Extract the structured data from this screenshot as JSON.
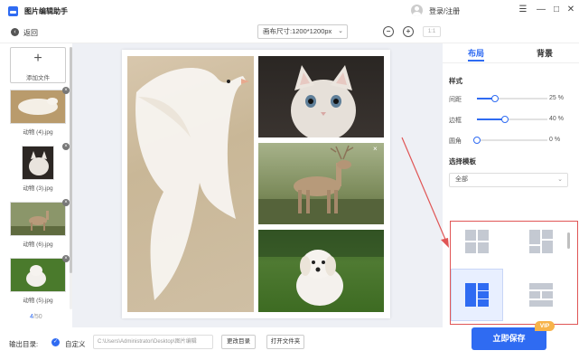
{
  "app": {
    "title": "图片编辑助手",
    "login_label": "登录/注册",
    "window_controls": [
      "menu-icon",
      "minimize-icon",
      "maximize-icon",
      "close-icon"
    ]
  },
  "toolbar": {
    "back_label": "返回",
    "canvas_size": "画布尺寸:1200*1200px",
    "ratio_label": "1:1",
    "zoom_out_icon": "zoom-out-icon",
    "zoom_in_icon": "zoom-in-icon"
  },
  "files": {
    "add_label": "添加文件",
    "items": [
      {
        "name": "动物 (4).jpg",
        "subject": "dove"
      },
      {
        "name": "动物 (3).jpg",
        "subject": "cat"
      },
      {
        "name": "动物 (6).jpg",
        "subject": "deer"
      },
      {
        "name": "动物 (5).jpg",
        "subject": "dog"
      }
    ],
    "count_current": "4",
    "count_total": "/50"
  },
  "tabs": [
    {
      "label": "布局",
      "active": true
    },
    {
      "label": "背景",
      "active": false
    }
  ],
  "style": {
    "section_title": "样式",
    "sliders": [
      {
        "label": "间距",
        "value": 25,
        "unit": "%"
      },
      {
        "label": "边框",
        "value": 40,
        "unit": "%"
      },
      {
        "label": "圆角",
        "value": 0,
        "unit": "%"
      }
    ]
  },
  "template": {
    "section_title": "选择模板",
    "selected": "全部"
  },
  "output": {
    "label": "输出目录:",
    "custom_label": "自定义",
    "path": "C:\\Users\\Administrator\\Desktop\\图片编辑",
    "change_dir_label": "更改目录",
    "open_folder_label": "打开文件夹"
  },
  "save": {
    "label": "立即保存",
    "badge": "VIP"
  },
  "colors": {
    "accent": "#2f6bf2",
    "annotation": "#e05555",
    "vip": "#f7b34a"
  }
}
